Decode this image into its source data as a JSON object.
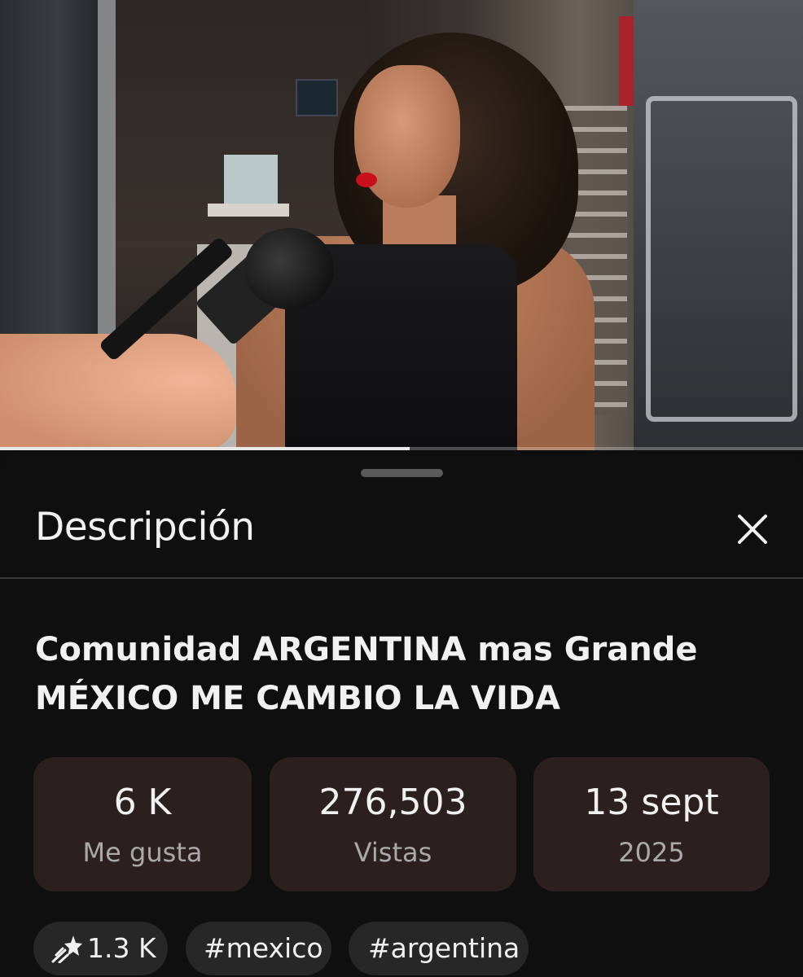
{
  "video": {
    "progress_fraction": 0.51
  },
  "sheet": {
    "title": "Descripción",
    "close_icon": "close-icon"
  },
  "description": {
    "video_title": "Comunidad ARGENTINA mas Grande MÉXICO ME CAMBIO LA VIDA",
    "stats": [
      {
        "value": "6 K",
        "label": "Me gusta"
      },
      {
        "value": "276,503",
        "label": "Vistas"
      },
      {
        "value": "13 sept",
        "label": "2025"
      }
    ],
    "chips": [
      {
        "icon": "sparkle-hype-icon",
        "text": "1.3 K"
      },
      {
        "text": "#mexico"
      },
      {
        "text": "#argentina"
      }
    ]
  },
  "colors": {
    "background": "#0f0f0f",
    "stat_card": "#2c201f",
    "chip": "#272727",
    "secondary_text": "#a9a9a9"
  }
}
